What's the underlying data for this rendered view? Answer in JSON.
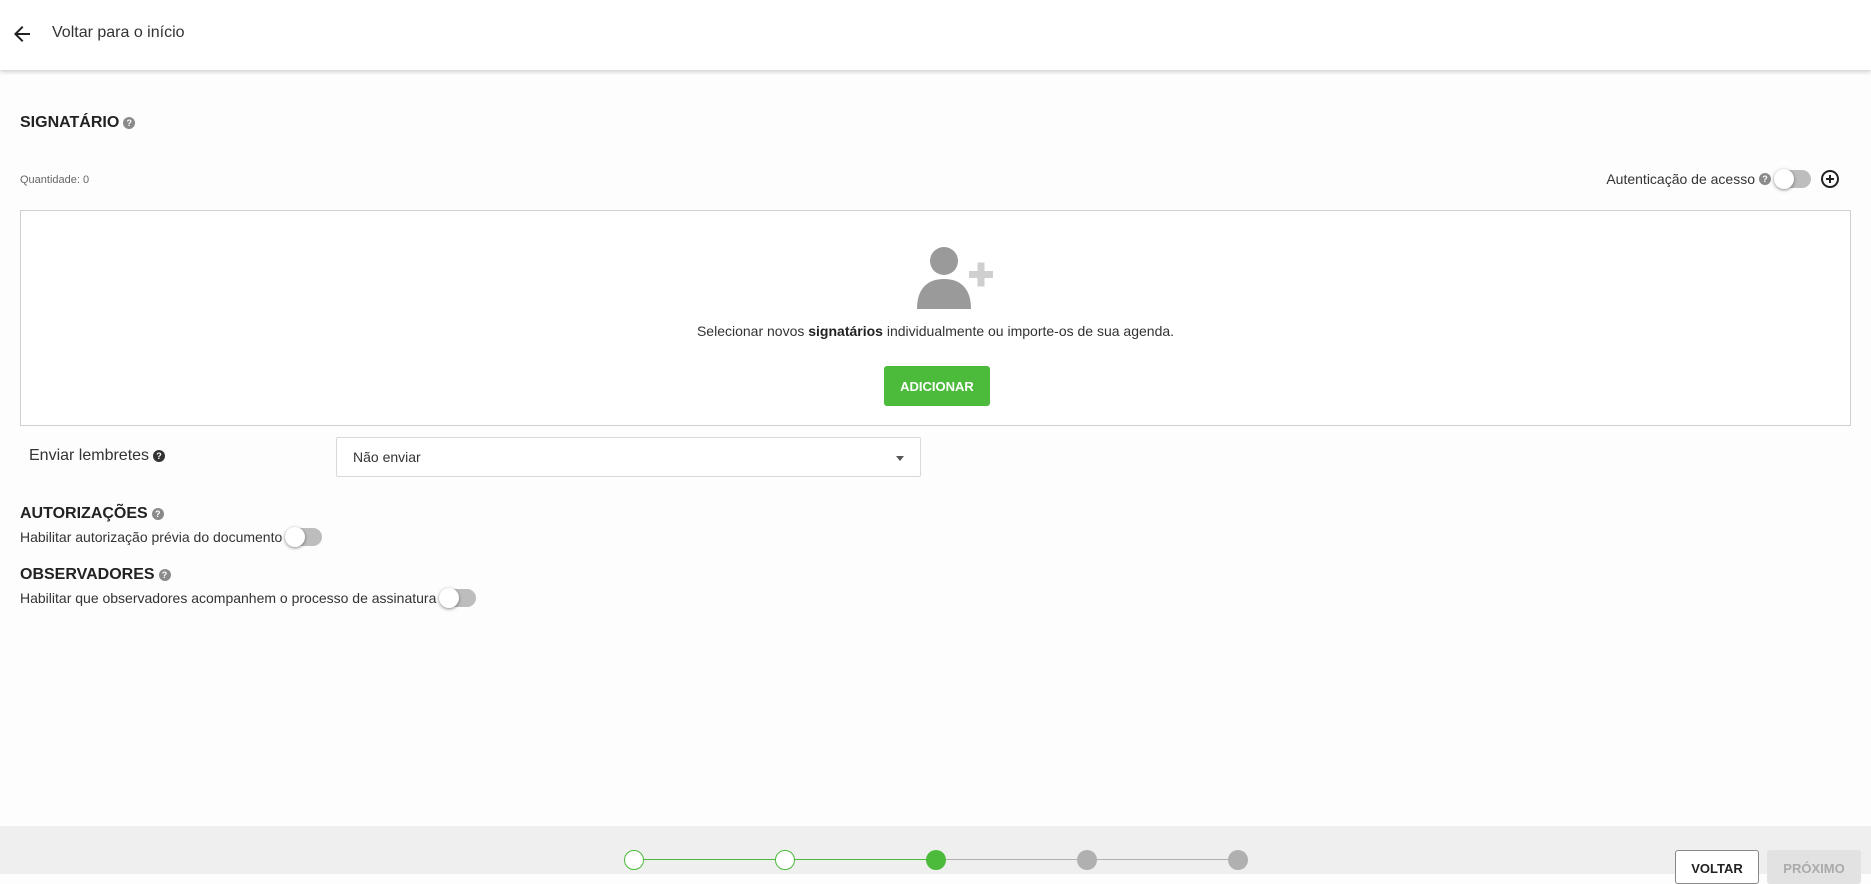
{
  "header": {
    "back_label": "Voltar para o início"
  },
  "signer_section": {
    "title": "SIGNATÁRIO",
    "quantity": "Quantidade: 0",
    "auth_label": "Autenticação de acesso",
    "auth_enabled": false,
    "empty_text_before": "Selecionar novos ",
    "empty_text_bold": "signatários",
    "empty_text_after": " individualmente ou importe-os de sua agenda.",
    "add_button": "ADICIONAR"
  },
  "reminders": {
    "label": "Enviar lembretes",
    "selected": "Não enviar"
  },
  "authorizations": {
    "title": "AUTORIZAÇÕES",
    "toggle_label": "Habilitar autorização prévia do documento",
    "enabled": false
  },
  "observers": {
    "title": "OBSERVADORES",
    "toggle_label": "Habilitar que observadores acompanhem o processo de assinatura",
    "enabled": false
  },
  "stepper": {
    "total_steps": 5,
    "current_step": 3
  },
  "footer": {
    "back_button": "VOLTAR",
    "next_button": "PRÓXIMO"
  },
  "colors": {
    "accent_green": "#4cbb3c",
    "inactive_gray": "#b0b0b0",
    "disabled_button": "#e2e2e2"
  },
  "icons": {
    "back": "arrow-left-icon",
    "help": "question-circle-icon",
    "add_person": "person-add-icon",
    "add": "plus-circle-icon",
    "dropdown": "caret-down-icon"
  }
}
